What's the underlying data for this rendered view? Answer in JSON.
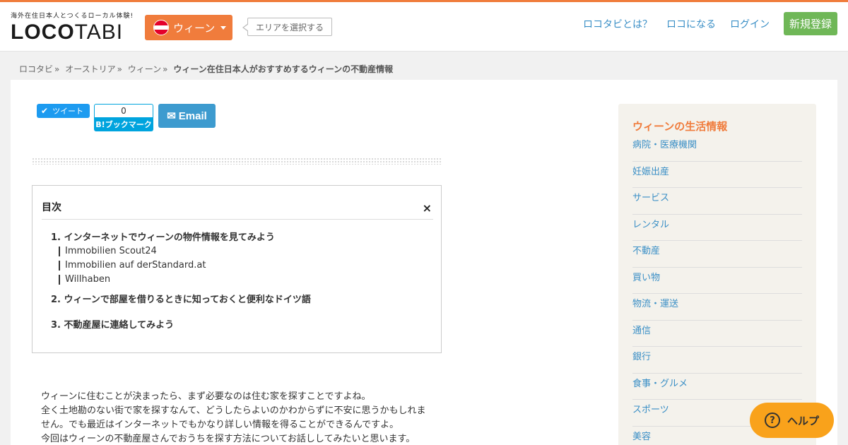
{
  "header": {
    "tagline": "海外在住日本人とつくるローカル体験!",
    "logo_part1": "LOCO",
    "logo_part2": "TABI",
    "city_label": "ウィーン",
    "area_select": "エリアを選択する",
    "nav": [
      "ロコタビとは？",
      "ロコになる",
      "ログイン"
    ],
    "signup": "新規登録",
    "flag_colors": [
      "#e4002b",
      "#ffffff",
      "#e4002b"
    ]
  },
  "breadcrumb": {
    "items": [
      "ロコタビ",
      "オーストリア",
      "ウィーン"
    ],
    "separator": "»",
    "current": "ウィーン在住日本人がおすすめするウィーンの不動産情報"
  },
  "share": {
    "tweet": "ツイート",
    "hatena_count": "0",
    "hatena_label": "B!ブックマーク",
    "email": "Email"
  },
  "toc": {
    "title": "目次",
    "close": "×",
    "items": [
      {
        "label": "1. インターネットでウィーンの物件情報を見てみよう",
        "sub": [
          "Immobilien Scout24",
          "Immobilien auf derStandard.at",
          "Willhaben"
        ]
      },
      {
        "label": "2. ウィーンで部屋を借りるときに知っておくと便利なドイツ語"
      },
      {
        "label": "3. 不動産屋に連絡してみよう"
      }
    ]
  },
  "article": {
    "lines": [
      "ウィーンに住むことが決まったら、まず必要なのは住む家を探すことですよね。",
      "全く土地勘のない街で家を探すなんて、どうしたらよいのかわからずに不安に思うかもしれま",
      "せん。でも最近はインターネットでもかなり詳しい情報を得ることができるんですよ。",
      "今回はウィーンの不動産屋さんでおうちを探す方法についてお話ししてみたいと思います。"
    ]
  },
  "sidebar": {
    "title": "ウィーンの生活情報",
    "items": [
      "病院・医療機関",
      "妊娠出産",
      "サービス",
      "レンタル",
      "不動産",
      "買い物",
      "物流・運送",
      "通信",
      "銀行",
      "食事・グルメ",
      "スポーツ",
      "美容"
    ]
  },
  "help": {
    "label": "ヘルプ"
  },
  "colors": {
    "accent": "#f07c3c",
    "link": "#3a8fc6",
    "signup": "#6fb757",
    "help": "#f9a21b"
  }
}
